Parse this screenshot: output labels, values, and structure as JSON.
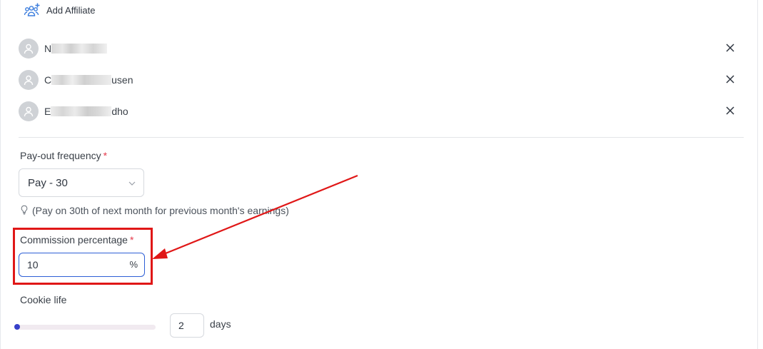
{
  "header": {
    "add_affiliate_label": "Add Affiliate",
    "add_affiliate_icon": "add-users-icon",
    "accent_color": "#3b7ddd"
  },
  "affiliates": [
    {
      "name_start": "N",
      "name_end": "",
      "avatar_icon": "user-icon",
      "remove_icon": "close-icon"
    },
    {
      "name_start": "C",
      "name_end": "usen",
      "avatar_icon": "user-icon",
      "remove_icon": "close-icon"
    },
    {
      "name_start": "E",
      "name_end": "dho",
      "avatar_icon": "user-icon",
      "remove_icon": "close-icon"
    }
  ],
  "payout": {
    "label": "Pay-out frequency",
    "required_mark": "*",
    "selected": "Pay - 30",
    "hint": "(Pay on 30th of next month for previous month's earnings)",
    "hint_icon": "lightbulb-icon"
  },
  "commission": {
    "label": "Commission percentage",
    "required_mark": "*",
    "value": "10",
    "unit": "%"
  },
  "cookie": {
    "label": "Cookie life",
    "value": "2",
    "unit_label": "days",
    "slider_level": 0
  },
  "annotation": {
    "highlight_color": "#e01717"
  }
}
